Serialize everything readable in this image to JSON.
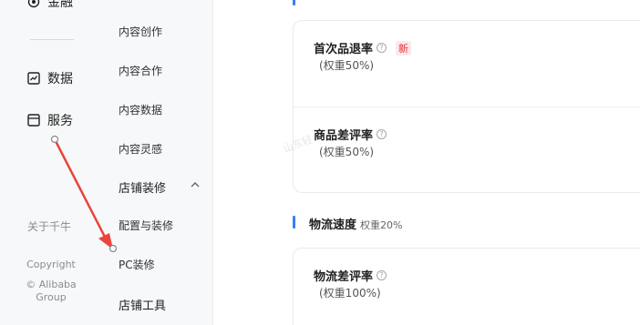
{
  "nav_primary": {
    "items": [
      {
        "label": "金融",
        "icon": "eye-icon"
      },
      {
        "label": "数据",
        "icon": "chart-icon"
      },
      {
        "label": "服务",
        "icon": "service-icon"
      }
    ],
    "about": "关于千牛",
    "copyright": [
      "Copyright",
      "© Alibaba",
      "Group"
    ]
  },
  "nav_secondary": {
    "items": [
      "内容创作",
      "内容合作",
      "内容数据",
      "内容灵感"
    ],
    "group_shop_decor": "店铺装修",
    "sub_items": [
      "配置与装修",
      "PC装修"
    ],
    "group_shop_tools": "店铺工具"
  },
  "main": {
    "card1": {
      "metric1": {
        "title": "首次品退率",
        "badge": "新",
        "weight": "(权重50%)"
      },
      "metric2": {
        "title": "商品差评率",
        "weight": "(权重50%)"
      }
    },
    "section_logistics": {
      "title": "物流速度",
      "weight": "权重20%"
    },
    "card2": {
      "metric1": {
        "title": "物流差评率",
        "weight": "(权重100%)"
      }
    },
    "watermark": "山东轻"
  },
  "colors": {
    "accent": "#3b7ff2",
    "badge_red": "#e0303a",
    "annotation_red": "#e8453c"
  }
}
